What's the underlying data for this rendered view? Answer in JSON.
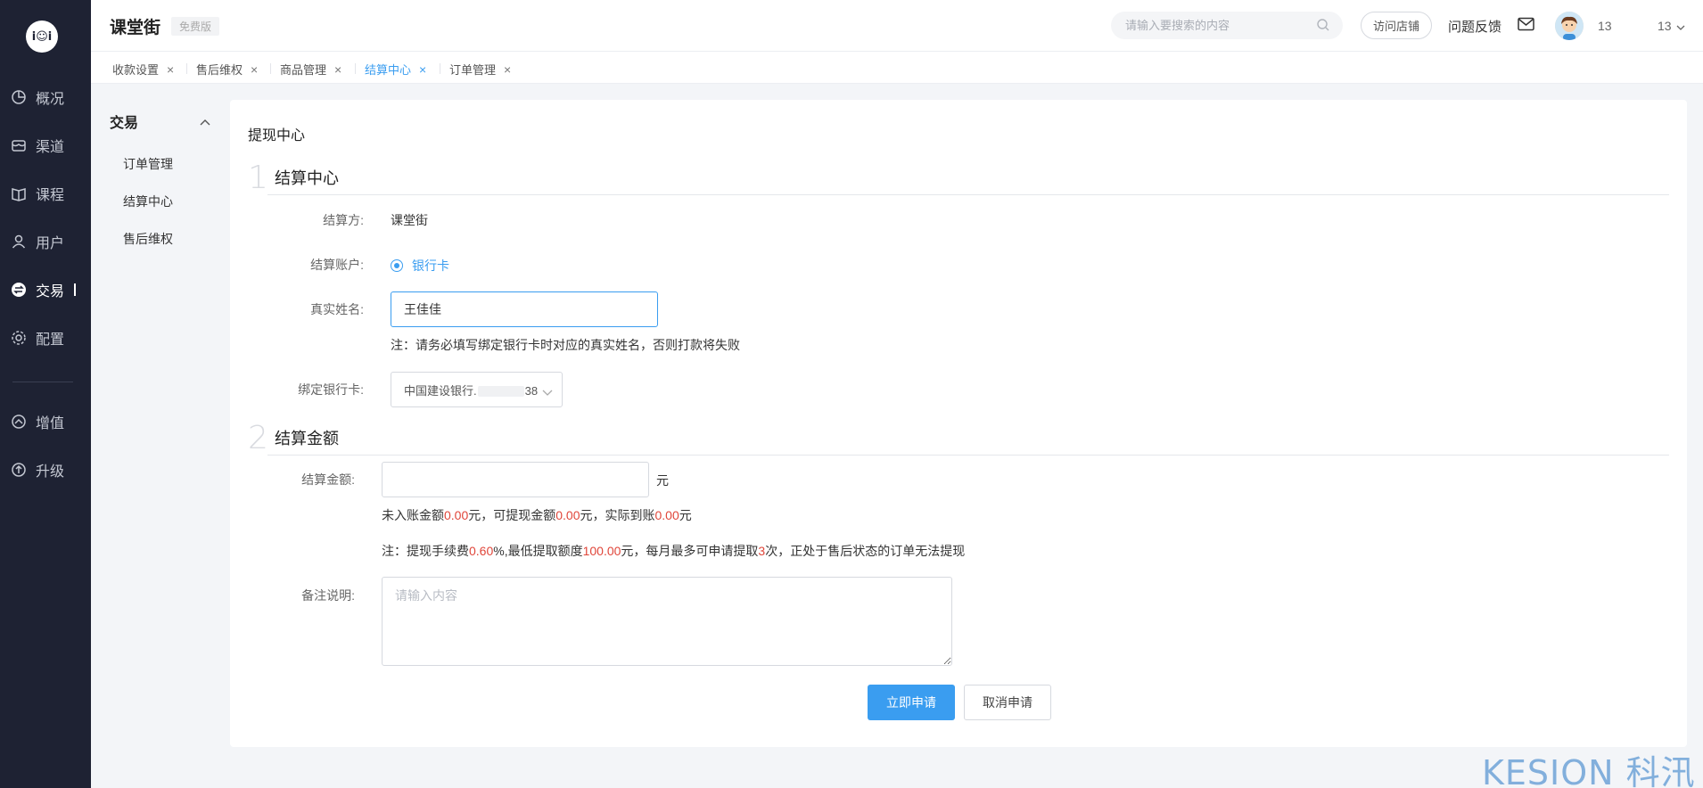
{
  "sidebar": {
    "logo_text": "i☺i",
    "items": [
      {
        "label": "概况",
        "icon": "chart-pie-icon"
      },
      {
        "label": "渠道",
        "icon": "store-icon"
      },
      {
        "label": "课程",
        "icon": "book-icon"
      },
      {
        "label": "用户",
        "icon": "user-icon"
      },
      {
        "label": "交易",
        "icon": "exchange-icon",
        "active": true
      },
      {
        "label": "配置",
        "icon": "gear-icon"
      },
      {
        "label": "增值",
        "icon": "rocket-icon"
      },
      {
        "label": "升级",
        "icon": "upgrade-icon"
      }
    ]
  },
  "header": {
    "brand": "课堂街",
    "edition": "免费版",
    "search_placeholder": "请输入要搜索的内容",
    "visit_store": "访问店铺",
    "feedback": "问题反馈",
    "user_name": "13",
    "user_menu": "13"
  },
  "tabs": [
    {
      "label": "收款设置"
    },
    {
      "label": "售后维权"
    },
    {
      "label": "商品管理"
    },
    {
      "label": "结算中心",
      "active": true
    },
    {
      "label": "订单管理"
    }
  ],
  "subnav": {
    "title": "交易",
    "items": [
      "订单管理",
      "结算中心",
      "售后维权"
    ]
  },
  "main": {
    "title": "提现中心",
    "step1": {
      "num": "1",
      "title": "结算中心"
    },
    "settler_label": "结算方:",
    "settler_value": "课堂街",
    "account_label": "结算账户:",
    "account_option": "银行卡",
    "name_label": "真实姓名:",
    "name_value": "王佳佳",
    "name_note": "注：请务必填写绑定银行卡时对应的真实姓名，否则打款将失败",
    "bank_label": "绑定银行卡:",
    "bank_value_prefix": "中国建设银行.",
    "bank_value_suffix": "38",
    "step2": {
      "num": "2",
      "title": "结算金额"
    },
    "amount_label": "结算金额:",
    "amount_value": "",
    "amount_unit": "元",
    "summary": {
      "t1": "未入账金额",
      "v1": "0.00",
      "t2": "元，可提现金额",
      "v2": "0.00",
      "t3": "元，实际到账",
      "v3": "0.00",
      "t4": "元"
    },
    "fee_note": {
      "t1": "注：提现手续费",
      "v1": "0.60",
      "t2": "%,最低提取额度",
      "v2": "100.00",
      "t3": "元，每月最多可申请提取",
      "v3": "3",
      "t4": "次，正处于售后状态的订单无法提现"
    },
    "remark_label": "备注说明:",
    "remark_placeholder": "请输入内容",
    "submit": "立即申请",
    "cancel": "取消申请"
  },
  "watermark": "KESION 科汛",
  "colors": {
    "accent": "#3a9df0",
    "highlight": "#e0463a",
    "sidebar_bg": "#1e2233"
  }
}
